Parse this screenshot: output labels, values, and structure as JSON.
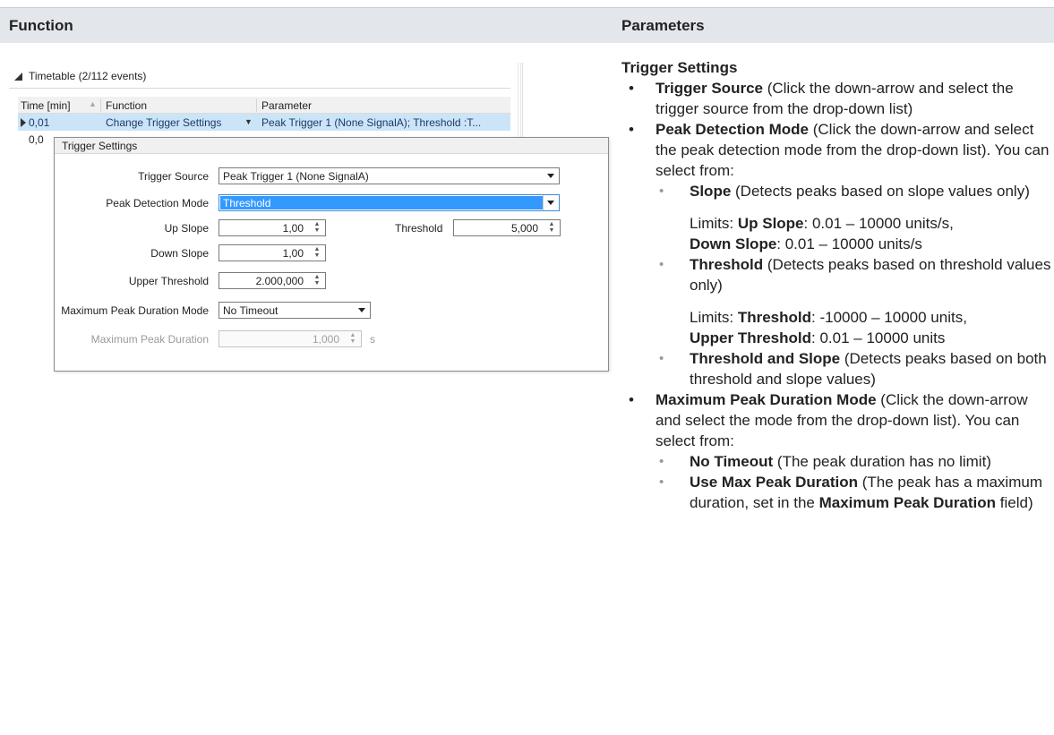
{
  "header": {
    "function_label": "Function",
    "parameters_label": "Parameters"
  },
  "timetable": {
    "title": "Timetable (2/112 events)",
    "columns": [
      "Time [min]",
      "Function",
      "Parameter"
    ],
    "rows": [
      {
        "time": "0,01",
        "function": "Change Trigger Settings",
        "parameter": "Peak Trigger 1 (None SignalA); Threshold :T..."
      },
      {
        "time": "0,0",
        "function": "",
        "parameter": ""
      }
    ]
  },
  "trigger_settings": {
    "title": "Trigger Settings",
    "trigger_source_label": "Trigger Source",
    "trigger_source_value": "Peak Trigger 1 (None SignalA)",
    "peak_detection_mode_label": "Peak Detection Mode",
    "peak_detection_mode_value": "Threshold",
    "up_slope_label": "Up Slope",
    "up_slope_value": "1,00",
    "threshold_label": "Threshold",
    "threshold_value": "5,000",
    "down_slope_label": "Down Slope",
    "down_slope_value": "1,00",
    "upper_threshold_label": "Upper Threshold",
    "upper_threshold_value": "2.000,000",
    "max_peak_duration_mode_label": "Maximum Peak Duration Mode",
    "max_peak_duration_mode_value": "No Timeout",
    "max_peak_duration_label": "Maximum Peak Duration",
    "max_peak_duration_value": "1,000",
    "max_peak_duration_unit": "s"
  },
  "params": {
    "section_title": "Trigger Settings",
    "trigger_source": {
      "name": "Trigger Source",
      "desc": " (Click the down-arrow and select the trigger source from the drop-down list)"
    },
    "peak_detection": {
      "name": "Peak Detection Mode",
      "desc": " (Click the down-arrow and select the peak detection mode from the drop-down list). You can select from:"
    },
    "slope": {
      "name": "Slope",
      "desc": " (Detects peaks based on slope values only)"
    },
    "slope_limits": {
      "prefix": "Limits: ",
      "up_name": "Up Slope",
      "up_range": ": 0.01 – 10000 units/s,",
      "down_name": "Down Slope",
      "down_range": ": 0.01 – 10000 units/s"
    },
    "threshold": {
      "name": "Threshold",
      "desc": " (Detects peaks based on threshold values only)"
    },
    "threshold_limits": {
      "prefix": "Limits: ",
      "th_name": "Threshold",
      "th_range": ": -10000 – 10000 units,",
      "upper_name": "Upper Threshold",
      "upper_range": ": 0.01 – 10000 units"
    },
    "threshold_slope": {
      "name": "Threshold and Slope",
      "desc": " (Detects peaks based on both threshold and slope values)"
    },
    "max_duration_mode": {
      "name": "Maximum Peak Duration Mode",
      "desc": " (Click the down-arrow and select the mode from the drop-down list). You can select from:"
    },
    "no_timeout": {
      "name": "No Timeout",
      "desc": " (The peak duration has no limit)"
    },
    "use_max": {
      "name": "Use Max Peak Duration",
      "desc": " (The peak has a maximum duration, set in the ",
      "field_name": "Maximum Peak Duration",
      "tail": " field)"
    }
  }
}
